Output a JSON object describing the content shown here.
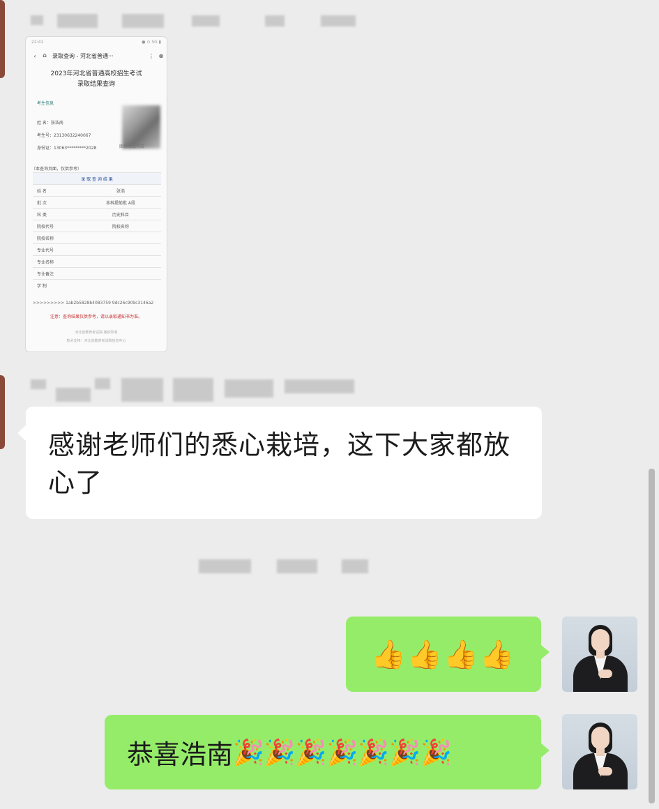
{
  "card": {
    "status_time": "22:41",
    "status_right": "● ⊙ 5G ▮",
    "nav_title": "录取查询 - 河北省普通···",
    "title_line1": "2023年河北省普通高校招生考试",
    "title_line2": "录取结果查询",
    "section": "考生信息",
    "info_name": "姓    名：张浩南",
    "info_exam": "考生号：23130632240067",
    "info_id": "身份证：13063*********2028",
    "photo_caption": "图像加载完成",
    "table_note": "（本查询页面，仅供参考）",
    "table_header": "录 取 查 询 结 果",
    "rows": [
      {
        "k": "姓      名",
        "v": "张浩"
      },
      {
        "k": "批      次",
        "v": "本科提前批 A段"
      },
      {
        "k": "科      类",
        "v": "历史科目"
      },
      {
        "k": "院校代号",
        "v": "院校名称"
      },
      {
        "k": "院校名称",
        "v": ""
      },
      {
        "k": "专业代号",
        "v": ""
      },
      {
        "k": "专业名称",
        "v": ""
      },
      {
        "k": "专业备注",
        "v": ""
      },
      {
        "k": "学      制",
        "v": ""
      }
    ],
    "hash": ">>>>>>>>>  1ab2b5828b4083759 9dc26c909c3146a2",
    "warning": "注意：查询结果仅供参考，请以录取通知书为准。",
    "footer1": "河北省教育考试院 版权所有",
    "footer2": "技术支持：河北省教育考试院信息中心"
  },
  "messages": [
    {
      "type": "incoming",
      "text": "感谢老师们的悉心栽培，这下大家都放心了"
    },
    {
      "type": "outgoing",
      "emoji": "👍👍👍👍"
    },
    {
      "type": "outgoing",
      "text": "恭喜浩南",
      "emoji": "🎉🎉🎉🎉🎉🎉🎉"
    }
  ],
  "colors": {
    "background": "#ececec",
    "incoming_bubble": "#ffffff",
    "outgoing_bubble": "#95ec69"
  }
}
